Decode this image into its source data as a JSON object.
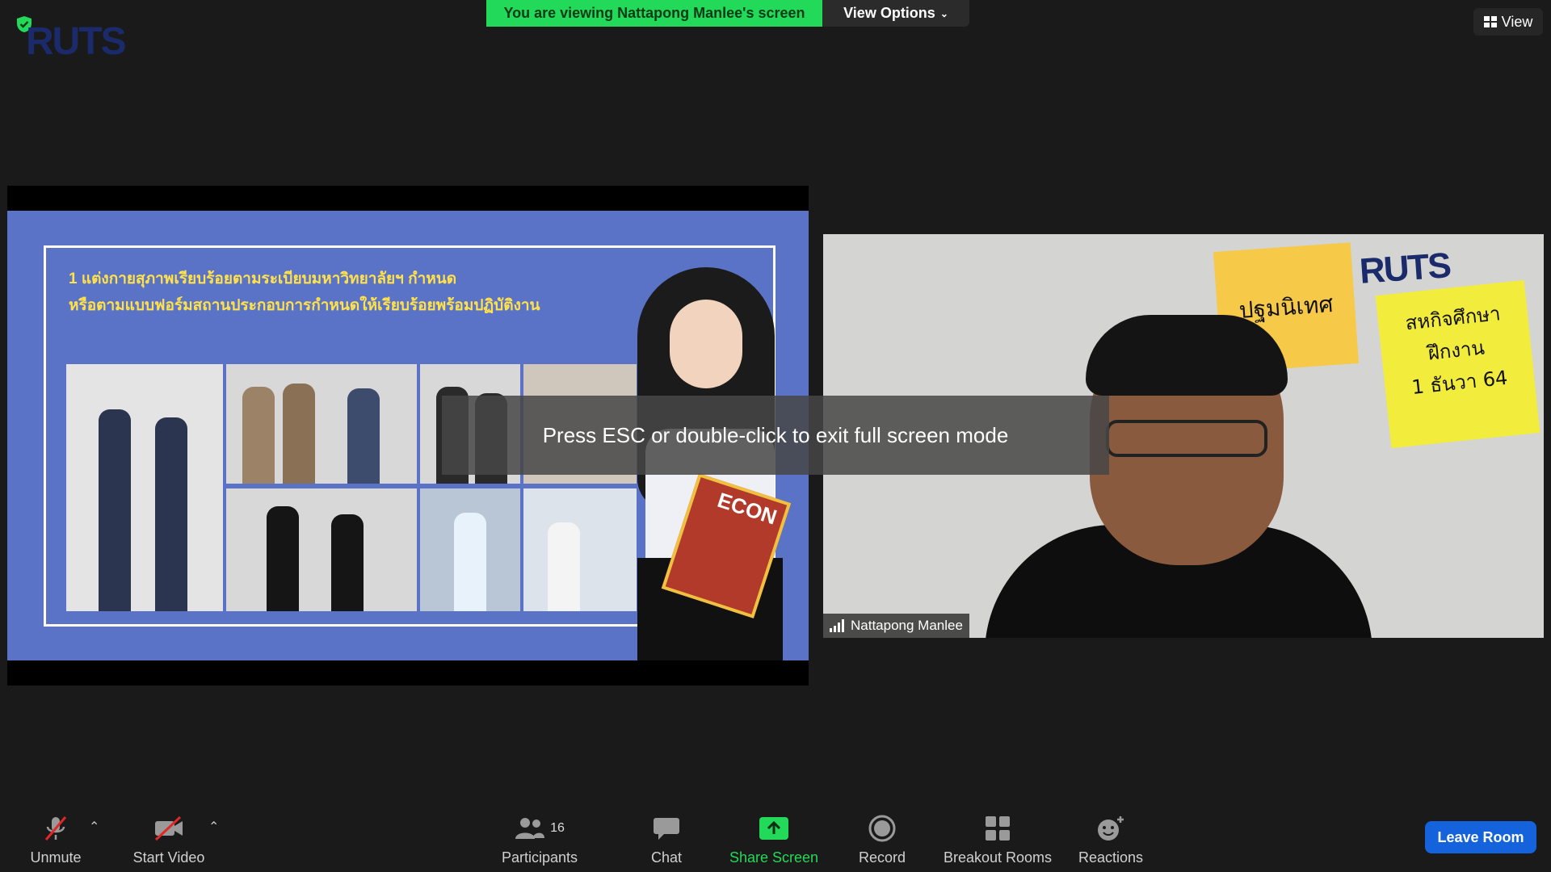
{
  "app": {
    "banner_text": "You are viewing Nattapong Manlee's screen",
    "view_options_label": "View Options",
    "view_label": "View",
    "logo_text": "RUTS"
  },
  "shared_screen": {
    "slide_line1": "1 แต่งกายสุภาพเรียบร้อยตามระเบียบมหาวิทยาลัยฯ กำหนด",
    "slide_line2": "หรือตามแบบฟอร์มสถานประกอบการกำหนดให้เรียบร้อยพร้อมปฏิบัติงาน",
    "magazine_text": "ECON"
  },
  "video_tile": {
    "participant_name": "Nattapong Manlee",
    "note1_text": "ปฐมนิเทศ",
    "note2_line1": "สหกิจศึกษา",
    "note2_line2": "ฝึกงาน",
    "note2_line3": "1 ธันวา 64",
    "logo_text": "RUTS"
  },
  "overlay": {
    "esc_message": "Press ESC or double-click to exit full screen mode"
  },
  "toolbar": {
    "unmute_label": "Unmute",
    "start_video_label": "Start Video",
    "participants_label": "Participants",
    "participants_count": "16",
    "chat_label": "Chat",
    "share_screen_label": "Share Screen",
    "record_label": "Record",
    "breakout_label": "Breakout Rooms",
    "reactions_label": "Reactions",
    "leave_label": "Leave Room"
  },
  "colors": {
    "background": "#1a1a1a",
    "banner_green": "#23d959",
    "slide_blue": "#5b73c6",
    "leave_blue": "#1463dd",
    "mute_red": "#e02828"
  }
}
